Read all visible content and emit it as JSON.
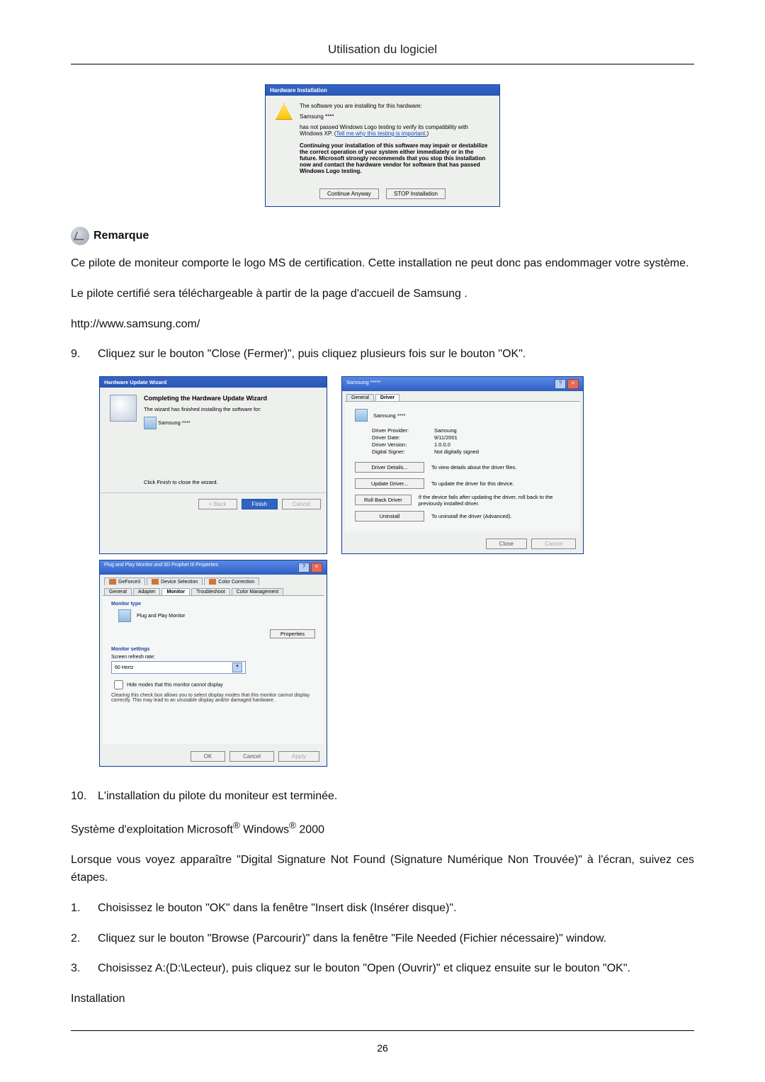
{
  "header": {
    "title": "Utilisation du logiciel"
  },
  "dialog1": {
    "title": "Hardware Installation",
    "line1": "The software you are installing for this hardware:",
    "line2": "Samsung ****",
    "line3_a": "has not passed Windows Logo testing to verify its compatibility with Windows XP. (",
    "line3_link": "Tell me why this testing is important.",
    "line3_b": ")",
    "bold": "Continuing your installation of this software may impair or destabilize the correct operation of your system either immediately or in the future. Microsoft strongly recommends that you stop this installation now and contact the hardware vendor for software that has passed Windows Logo testing.",
    "btn_continue": "Continue Anyway",
    "btn_stop": "STOP Installation"
  },
  "remarque": {
    "label": "Remarque"
  },
  "para1": "Ce pilote de moniteur comporte le logo MS de certification. Cette installation ne peut donc pas endommager votre système.",
  "para2": "Le pilote certifié sera téléchargeable à partir de la page d'accueil de Samsung .",
  "para3": "http://www.samsung.com/",
  "item9": {
    "num": "9.",
    "text": "Cliquez sur le bouton \"Close (Fermer)\", puis cliquez plusieurs fois sur le bouton \"OK\"."
  },
  "wizard": {
    "title": "Hardware Update Wizard",
    "heading": "Completing the Hardware Update Wizard",
    "line1": "The wizard has finished installing the software for:",
    "device": "Samsung ****",
    "finish_hint": "Click Finish to close the wizard.",
    "btn_back": "< Back",
    "btn_finish": "Finish",
    "btn_cancel": "Cancel"
  },
  "driverprop": {
    "title": "Samsung *****",
    "tab_general": "General",
    "tab_driver": "Driver",
    "device": "Samsung ****",
    "provider_k": "Driver Provider:",
    "provider_v": "Samsung",
    "date_k": "Driver Date:",
    "date_v": "9/11/2001",
    "version_k": "Driver Version:",
    "version_v": "1.0.0.0",
    "signer_k": "Digital Signer:",
    "signer_v": "Not digitally signed",
    "btn_details": "Driver Details...",
    "btn_details_d": "To view details about the driver files.",
    "btn_update": "Update Driver...",
    "btn_update_d": "To update the driver for this device.",
    "btn_rollback": "Roll Back Driver",
    "btn_rollback_d": "If the device fails after updating the driver, roll back to the previously installed driver.",
    "btn_uninstall": "Uninstall",
    "btn_uninstall_d": "To uninstall the driver (Advanced).",
    "btn_close": "Close",
    "btn_cancel": "Cancel"
  },
  "plugprop": {
    "title": "Plug and Play Monitor and 3D Prophet III Properties",
    "tabs_top": [
      "GeForce3",
      "Device Selection",
      "Color Correction"
    ],
    "tabs_bottom": [
      "General",
      "Adapter",
      "Monitor",
      "Troubleshoot",
      "Color Management"
    ],
    "section1": "Monitor type",
    "monitor": "Plug and Play Monitor",
    "btn_properties": "Properties",
    "section2": "Monitor settings",
    "refresh_label": "Screen refresh rate:",
    "refresh_value": "60 Hertz",
    "hide_label": "Hide modes that this monitor cannot display",
    "hide_desc": "Clearing this check box allows you to select display modes that this monitor cannot display correctly. This may lead to an unusable display and/or damaged hardware.",
    "btn_ok": "OK",
    "btn_cancel": "Cancel",
    "btn_apply": "Apply"
  },
  "item10": {
    "num": "10.",
    "text": "L'installation du pilote du moniteur est terminée."
  },
  "os_line_a": "Système d'exploitation Microsoft",
  "os_line_b": " Windows",
  "os_line_c": " 2000",
  "reg": "®",
  "para4": "Lorsque vous voyez apparaître \"Digital Signature Not Found (Signature Numérique Non Trouvée)\" à l'écran, suivez ces étapes.",
  "step1": {
    "num": "1.",
    "text": "Choisissez le bouton \"OK\" dans la fenêtre \"Insert disk (Insérer disque)\"."
  },
  "step2": {
    "num": "2.",
    "text": "Cliquez sur le bouton \"Browse (Parcourir)\" dans la fenêtre \"File Needed (Fichier nécessaire)\" window."
  },
  "step3": {
    "num": "3.",
    "text": "Choisissez A:(D:\\Lecteur), puis cliquez sur le bouton \"Open (Ouvrir)\" et cliquez ensuite sur le bouton \"OK\"."
  },
  "install": "Installation",
  "page_number": "26"
}
